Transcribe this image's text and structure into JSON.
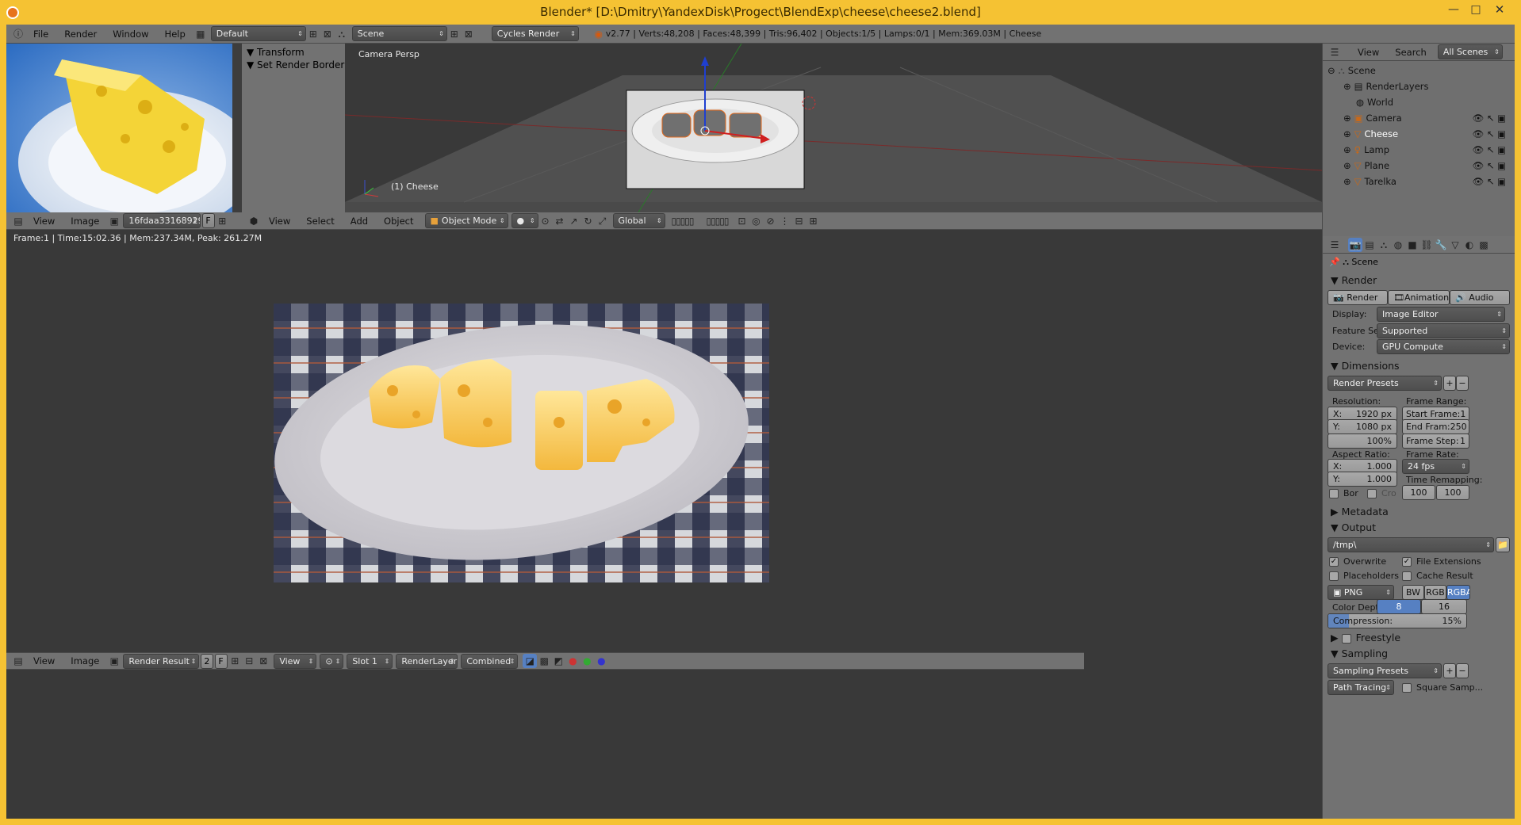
{
  "window": {
    "title": "Blender* [D:\\Dmitry\\YandexDisk\\Progect\\BlendExp\\cheese\\cheese2.blend]"
  },
  "topbar": {
    "menus": [
      "File",
      "Render",
      "Window",
      "Help"
    ],
    "layout": "Default",
    "scene": "Scene",
    "engine": "Cycles Render",
    "stats": "v2.77 | Verts:48,208 | Faces:48,399 | Tris:96,402 | Objects:1/5 | Lamps:0/1 | Mem:369.03M | Cheese"
  },
  "viewport": {
    "label": "Camera Persp",
    "object": "(1) Cheese",
    "toolshelf": [
      "Transform",
      "Set Render Border"
    ],
    "menus": [
      "View",
      "Select",
      "Add",
      "Object"
    ],
    "mode": "Object Mode",
    "orientation": "Global"
  },
  "thumb_editor": {
    "menus": [
      "View",
      "Image"
    ],
    "image_name": "16fdaa33168929...",
    "f": "F"
  },
  "image_editor": {
    "status": "Frame:1 | Time:15:02.36 | Mem:237.34M, Peak: 261.27M",
    "menus": [
      "View",
      "Image"
    ],
    "image_name": "Render Result",
    "users": "2",
    "f": "F",
    "view": "View",
    "slot": "Slot 1",
    "layer": "RenderLayer",
    "pass": "Combined"
  },
  "outliner": {
    "menus": [
      "View",
      "Search"
    ],
    "display": "All Scenes",
    "items": [
      "Scene",
      "RenderLayers",
      "World",
      "Camera",
      "Cheese",
      "Lamp",
      "Plane",
      "Tarelka"
    ]
  },
  "properties": {
    "context": "Scene",
    "render": {
      "title": "Render",
      "buttons": [
        "Render",
        "Animation",
        "Audio"
      ],
      "display_label": "Display:",
      "display": "Image Editor",
      "feature_label": "Feature Set:",
      "feature": "Supported",
      "device_label": "Device:",
      "device": "GPU Compute"
    },
    "dimensions": {
      "title": "Dimensions",
      "presets": "Render Presets",
      "resolution_label": "Resolution:",
      "res_x_label": "X:",
      "res_x": "1920 px",
      "res_y_label": "Y:",
      "res_y": "1080 px",
      "res_pct": "100%",
      "frame_range_label": "Frame Range:",
      "start_label": "Start Frame:",
      "start": "1",
      "end_label": "End Fram:",
      "end": "250",
      "step_label": "Frame Step:",
      "step": "1",
      "aspect_label": "Aspect Ratio:",
      "asp_x_label": "X:",
      "asp_x": "1.000",
      "asp_y_label": "Y:",
      "asp_y": "1.000",
      "frame_rate_label": "Frame Rate:",
      "fps": "24 fps",
      "time_remap_label": "Time Remapping:",
      "remap_old": "100",
      "remap_new": "100",
      "bor": "Bor",
      "cro": "Cro"
    },
    "metadata": {
      "title": "Metadata"
    },
    "output": {
      "title": "Output",
      "path": "/tmp\\",
      "overwrite": "Overwrite",
      "file_ext": "File Extensions",
      "placeholders": "Placeholders",
      "cache": "Cache Result",
      "format": "PNG",
      "bw": "BW",
      "rgb": "RGB",
      "rgba": "RGBA",
      "depth_label": "Color Depth:",
      "depth8": "8",
      "depth16": "16",
      "compression_label": "Compression:",
      "compression": "15%",
      "compression_value": 0.15
    },
    "freestyle": {
      "title": "Freestyle"
    },
    "sampling": {
      "title": "Sampling",
      "presets": "Sampling Presets",
      "integrator": "Path Tracing",
      "square": "Square Samp..."
    }
  },
  "colors": {
    "accent": "#5680c2",
    "selected": "#4a7bc8",
    "titlebar": "#f5c233"
  }
}
